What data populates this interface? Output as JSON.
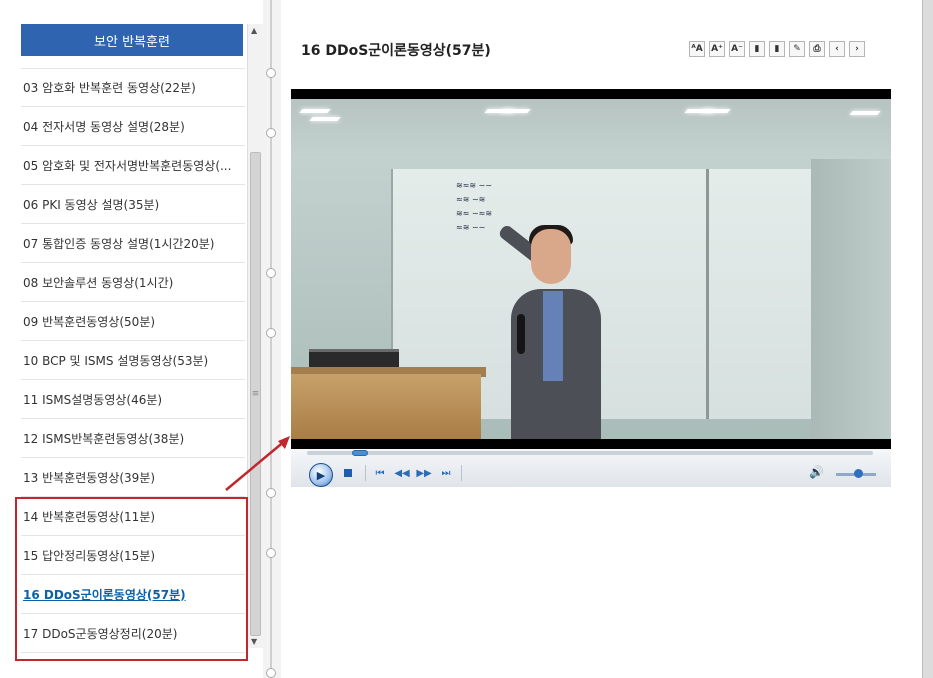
{
  "sidebar": {
    "header": "보안 반복훈련",
    "items": [
      {
        "label": "03 암호화 반복훈련 동영상(22분)"
      },
      {
        "label": "04 전자서명 동영상 설명(28분)"
      },
      {
        "label": "05 암호화 및 전자서명반복훈련동영상(..."
      },
      {
        "label": "06 PKI 동영상 설명(35분)"
      },
      {
        "label": "07 통합인증 동영상 설명(1시간20분)"
      },
      {
        "label": "08 보안솔루션 동영상(1시간)"
      },
      {
        "label": "09 반복훈련동영상(50분)"
      },
      {
        "label": "10 BCP 및 ISMS 설명동영상(53분)"
      },
      {
        "label": "11 ISMS설명동영상(46분)"
      },
      {
        "label": "12 ISMS반복훈련동영상(38분)"
      },
      {
        "label": "13 반복훈련동영상(39분)"
      },
      {
        "label": "14 반복훈련동영상(11분)"
      },
      {
        "label": "15 답안정리동영상(15분)"
      },
      {
        "label": "16 DDoS군이론동영상(57분)",
        "active": true
      },
      {
        "label": "17 DDoS군동영상정리(20분)"
      }
    ]
  },
  "main": {
    "title": "16 DDoS군이론동영상(57분)"
  },
  "player": {
    "progress_fraction": 0.08,
    "volume_fraction": 0.55
  },
  "colors": {
    "header_bg": "#2f64b1",
    "active_item": "#0b62a8",
    "annotation": "#c0282d"
  }
}
